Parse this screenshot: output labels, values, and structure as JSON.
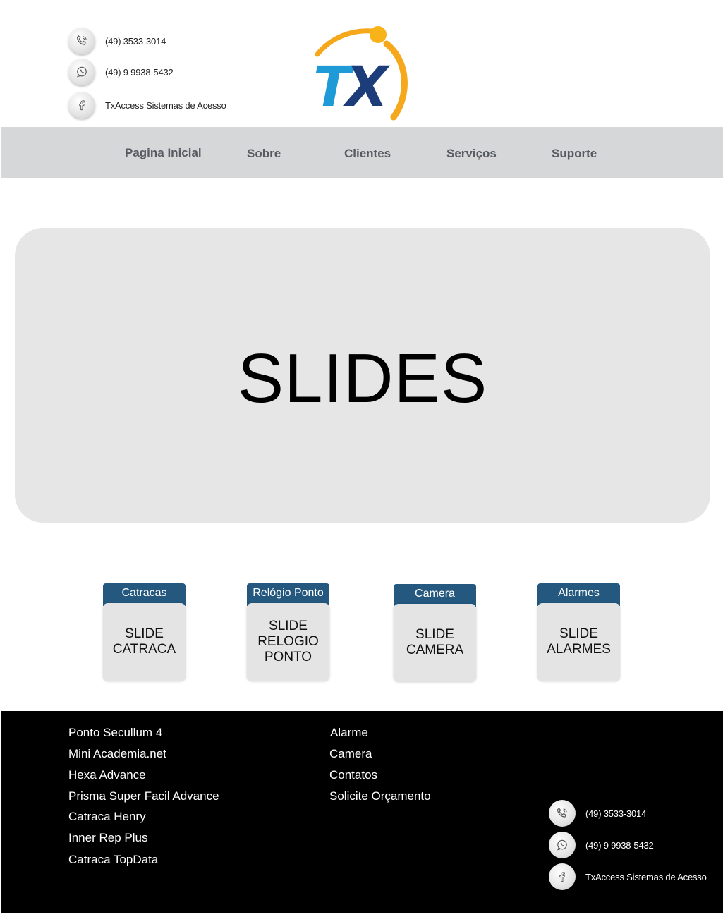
{
  "header": {
    "contacts": [
      {
        "icon": "phone-icon",
        "text": "(49) 3533-3014"
      },
      {
        "icon": "whatsapp-icon",
        "text": "(49) 9 9938-5432"
      },
      {
        "icon": "facebook-icon",
        "text": "TxAccess Sistemas de Acesso"
      }
    ],
    "logo": {
      "text": "TX",
      "colors": {
        "t": "#1e9ad6",
        "x": "#1d3d7a",
        "arc": "#f5a81c"
      }
    }
  },
  "nav": {
    "items": [
      "Pagina Inicial",
      "Sobre",
      "Clientes",
      "Serviços",
      "Suporte"
    ]
  },
  "hero": {
    "title": "SLIDES"
  },
  "cards": [
    {
      "title": "Catracas",
      "body": [
        "SLIDE",
        "CATRACA"
      ]
    },
    {
      "title": "Relógio Ponto",
      "body": [
        "SLIDE",
        "RELOGIO",
        "PONTO"
      ]
    },
    {
      "title": "Camera",
      "body": [
        "SLIDE",
        "CAMERA"
      ]
    },
    {
      "title": "Alarmes",
      "body": [
        "SLIDE",
        "ALARMES"
      ]
    }
  ],
  "footer": {
    "products": [
      "Ponto Secullum 4",
      "Mini Academia.net",
      "Hexa Advance",
      "Prisma Super Facil Advance",
      "Catraca Henry",
      "Inner Rep Plus",
      "Catraca TopData"
    ],
    "links": [
      "Alarme",
      "Camera",
      "Contatos",
      "Solicite Orçamento"
    ],
    "contacts": [
      {
        "icon": "phone-icon",
        "text": "(49) 3533-3014"
      },
      {
        "icon": "whatsapp-icon",
        "text": "(49) 9 9938-5432"
      },
      {
        "icon": "facebook-icon",
        "text": "TxAccess Sistemas de Acesso"
      }
    ]
  },
  "colors": {
    "nav_bg": "#d6d7d9",
    "card_header": "#24587f",
    "footer_bg": "#000000",
    "hero_bg": "#e6e6e6"
  }
}
